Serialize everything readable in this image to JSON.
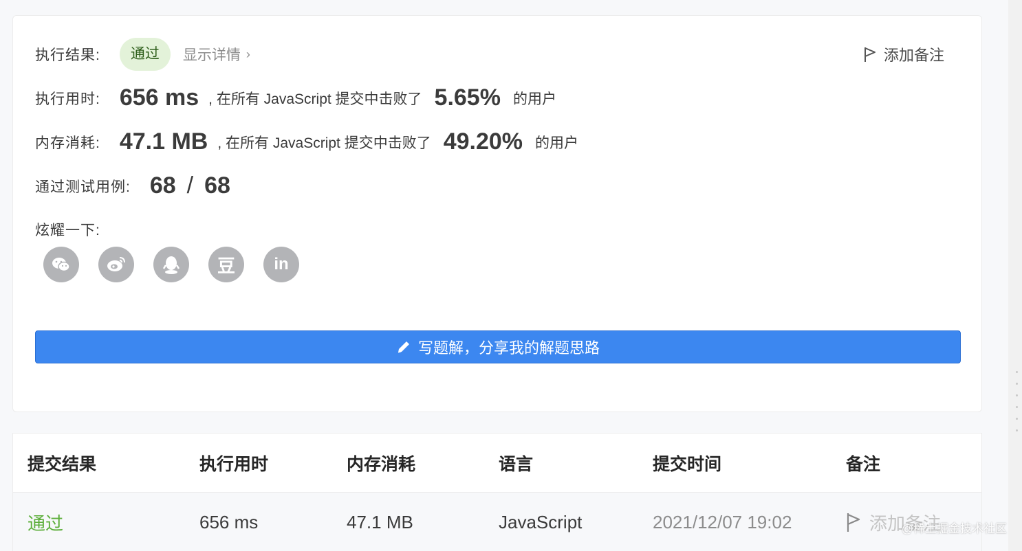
{
  "result": {
    "label": "执行结果:",
    "status": "通过",
    "details_label": "显示详情",
    "add_note": "添加备注"
  },
  "runtime": {
    "label": "执行用时:",
    "value": "656 ms",
    "middle": ", 在所有 JavaScript 提交中击败了",
    "percent": "5.65%",
    "suffix": "的用户"
  },
  "memory": {
    "label": "内存消耗:",
    "value": "47.1 MB",
    "middle": ", 在所有 JavaScript 提交中击败了",
    "percent": "49.20%",
    "suffix": "的用户"
  },
  "tests": {
    "label": "通过测试用例:",
    "passed": "68",
    "sep": "/",
    "total": "68"
  },
  "share": {
    "label": "炫耀一下:",
    "items": [
      {
        "name": "wechat-icon",
        "glyph": "◉"
      },
      {
        "name": "weibo-icon",
        "glyph": "◎"
      },
      {
        "name": "qq-icon",
        "glyph": "●"
      },
      {
        "name": "douban-icon",
        "glyph": "豆"
      },
      {
        "name": "linkedin-icon",
        "glyph": "in"
      }
    ]
  },
  "cta": {
    "label": "写题解，分享我的解题思路"
  },
  "table": {
    "headers": [
      "提交结果",
      "执行用时",
      "内存消耗",
      "语言",
      "提交时间",
      "备注"
    ],
    "row": {
      "status": "通过",
      "runtime": "656 ms",
      "memory": "47.1 MB",
      "language": "JavaScript",
      "time": "2021/12/07 19:02",
      "note": "添加备注"
    }
  },
  "watermark": "@稀土掘金技术社区",
  "colors": {
    "primary": "#3c87f0",
    "pass": "#5cae3a",
    "badge_bg": "#e3f2d9"
  }
}
